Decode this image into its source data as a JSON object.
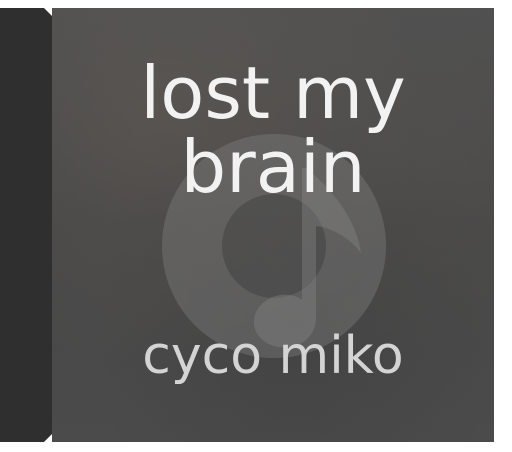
{
  "album": {
    "title_line1": "lost my",
    "title_line2": "brain",
    "artist": "cyco miko",
    "placeholder_icon": "music-note-disc-icon"
  },
  "colors": {
    "spine": "#2f2f2f",
    "cover_background": "#4a4a4a",
    "title_text": "#f2f2f2",
    "artist_text": "#d4d4d4"
  }
}
